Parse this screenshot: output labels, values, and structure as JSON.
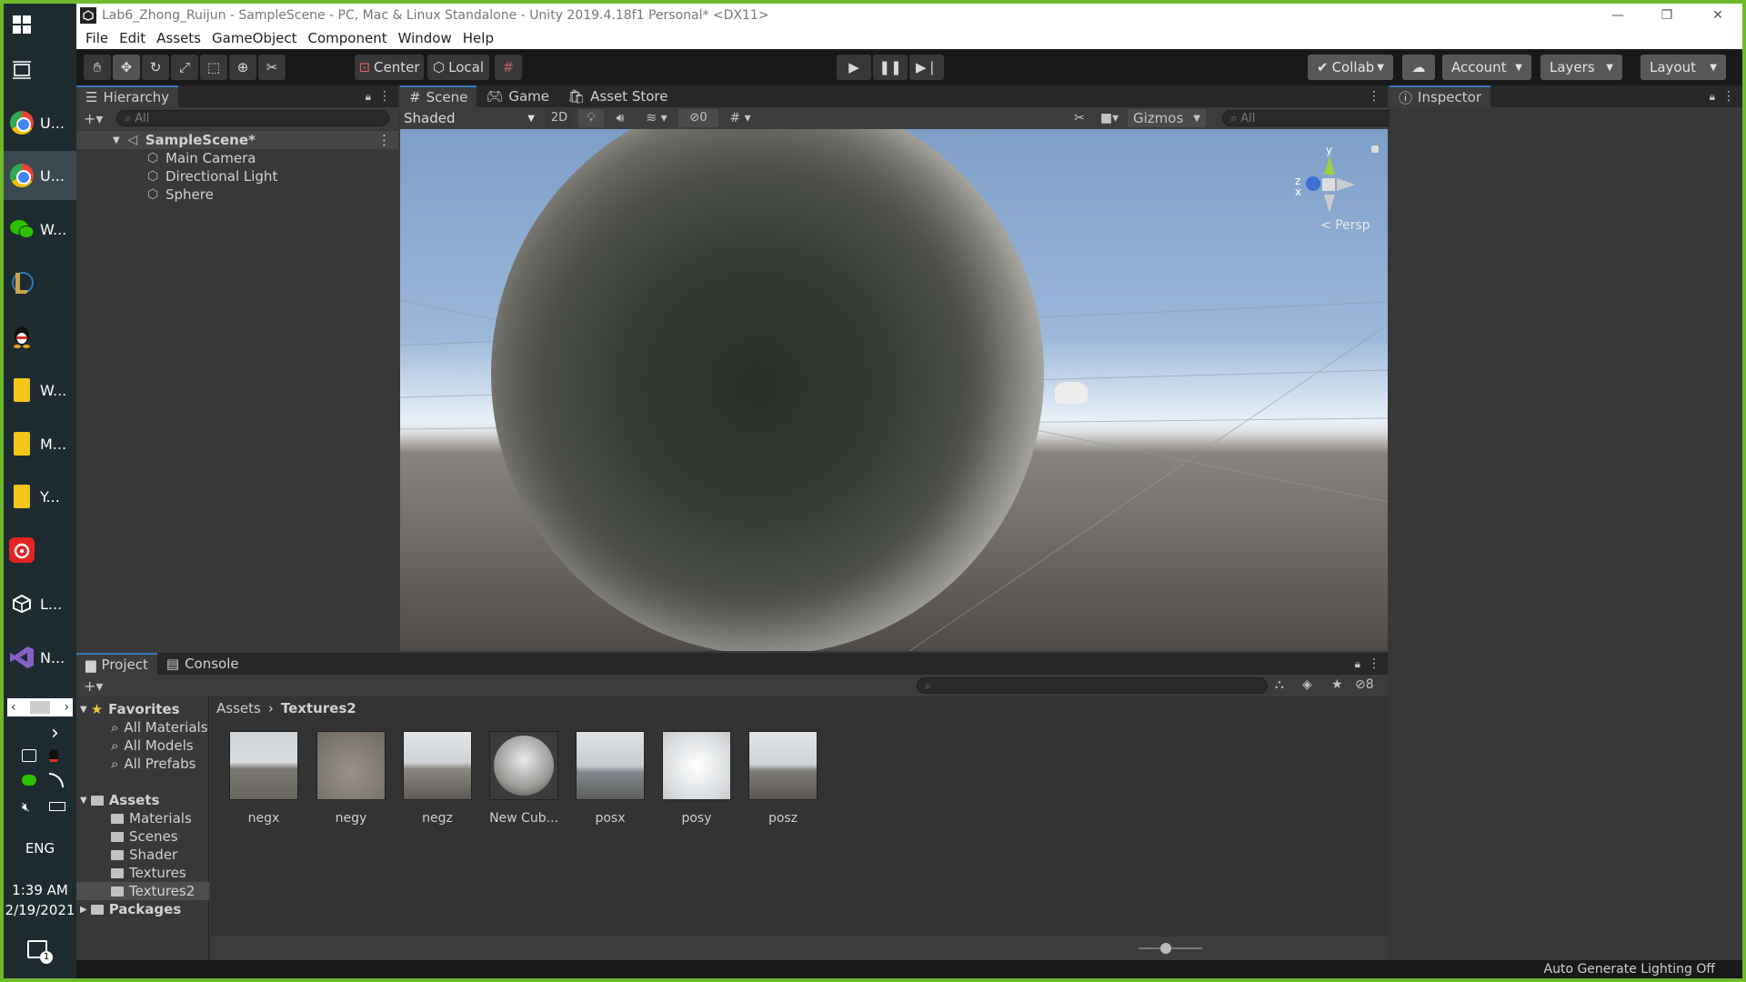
{
  "taskbar": {
    "items": [
      {
        "label": "U...",
        "icon": "chrome-icon"
      },
      {
        "label": "U...",
        "icon": "chrome-icon"
      },
      {
        "label": "W...",
        "icon": "wechat-icon"
      },
      {
        "label": "",
        "icon": "league-icon"
      },
      {
        "label": "",
        "icon": "qq-icon"
      },
      {
        "label": "W...",
        "icon": "folder-icon"
      },
      {
        "label": "M...",
        "icon": "folder-icon"
      },
      {
        "label": "Y...",
        "icon": "folder-icon"
      },
      {
        "label": "",
        "icon": "netease-music-icon"
      },
      {
        "label": "L...",
        "icon": "unity-icon"
      },
      {
        "label": "N...",
        "icon": "visual-studio-icon"
      }
    ],
    "lang": "ENG",
    "time": "1:39 AM",
    "date": "2/19/2021",
    "notification_count": "1"
  },
  "window": {
    "title": "Lab6_Zhong_Ruijun - SampleScene - PC, Mac & Linux Standalone - Unity 2019.4.18f1 Personal* <DX11>"
  },
  "menu": [
    "File",
    "Edit",
    "Assets",
    "GameObject",
    "Component",
    "Window",
    "Help"
  ],
  "toolbar": {
    "pivot": "Center",
    "space": "Local",
    "collab": "Collab",
    "account": "Account",
    "layers": "Layers",
    "layout": "Layout"
  },
  "hierarchy": {
    "tab": "Hierarchy",
    "search_placeholder": "All",
    "scene": "SampleScene*",
    "objects": [
      "Main Camera",
      "Directional Light",
      "Sphere"
    ]
  },
  "scene": {
    "tabs": [
      "Scene",
      "Game",
      "Asset Store"
    ],
    "active_tab": "Scene",
    "shading": "Shaded",
    "mode_2d": "2D",
    "hidden_count": "0",
    "gizmos": "Gizmos",
    "search_placeholder": "All",
    "gizmo_axes": {
      "y": "y",
      "z": "z",
      "x": "x"
    },
    "persp": "Persp"
  },
  "inspector": {
    "tab": "Inspector"
  },
  "project": {
    "tabs": [
      "Project",
      "Console"
    ],
    "active_tab": "Project",
    "hidden_count": "8",
    "breadcrumb": [
      "Assets",
      "Textures2"
    ],
    "favorites_label": "Favorites",
    "favorites": [
      "All Materials",
      "All Models",
      "All Prefabs"
    ],
    "assets_label": "Assets",
    "asset_folders": [
      "Materials",
      "Scenes",
      "Shader",
      "Textures",
      "Textures2"
    ],
    "selected_folder": "Textures2",
    "packages_label": "Packages",
    "files": [
      "negx",
      "negy",
      "negz",
      "New Cub...",
      "posx",
      "posy",
      "posz"
    ]
  },
  "status": {
    "text": "Auto Generate Lighting Off"
  },
  "colors": {
    "accent": "#3a79bb",
    "desktop_border": "#6fba2c",
    "editor_bg": "#383838",
    "panel_header": "#282828",
    "toolbar": "#191919"
  }
}
